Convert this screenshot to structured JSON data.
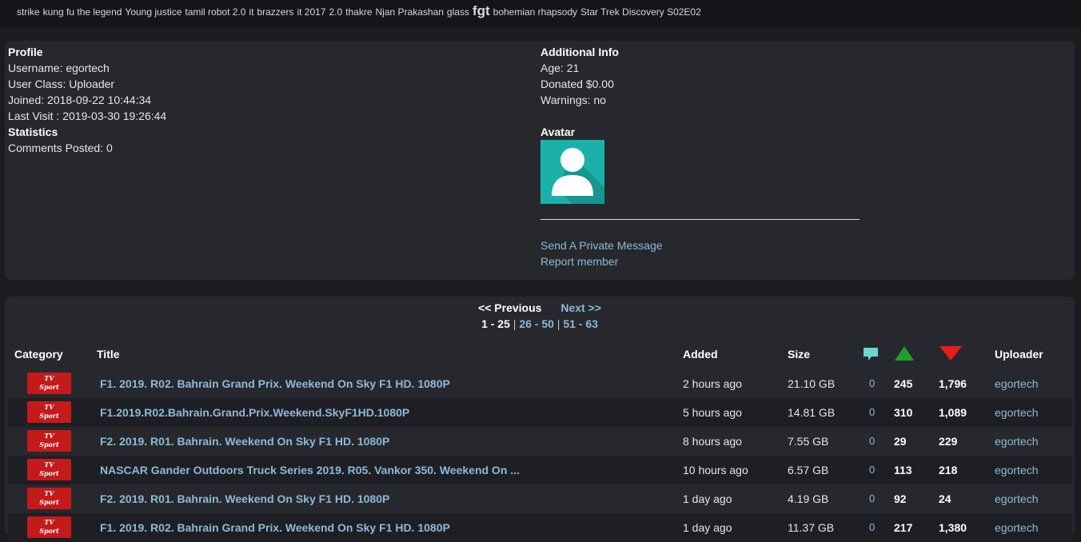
{
  "tag_cloud": [
    {
      "label": "strike",
      "big": false
    },
    {
      "label": "kung fu the legend",
      "big": false
    },
    {
      "label": "Young justice",
      "big": false
    },
    {
      "label": "tamil robot 2.0",
      "big": false
    },
    {
      "label": "it",
      "big": false
    },
    {
      "label": "brazzers",
      "big": false
    },
    {
      "label": "it 2017",
      "big": false
    },
    {
      "label": "2.0",
      "big": false
    },
    {
      "label": "thakre",
      "big": false
    },
    {
      "label": "Njan Prakashan",
      "big": false
    },
    {
      "label": "glass",
      "big": false
    },
    {
      "label": "fgt",
      "big": true
    },
    {
      "label": "bohemian rhapsody",
      "big": false
    },
    {
      "label": "Star Trek Discovery S02E02",
      "big": false
    }
  ],
  "profile": {
    "heading": "Profile",
    "username": "Username: egortech",
    "user_class": "User Class: Uploader",
    "joined": "Joined: 2018-09-22 10:44:34",
    "last_visit": "Last Visit : 2019-03-30 19:26:44",
    "stats_heading": "Statistics",
    "comments_posted": "Comments Posted: 0"
  },
  "additional": {
    "heading": "Additional Info",
    "age": "Age: 21",
    "donated": "Donated $0.00",
    "warnings": "Warnings: no",
    "avatar_heading": "Avatar",
    "send_pm": "Send A Private Message",
    "report": "Report member",
    "avatar_color": "#19b1a8"
  },
  "pager": {
    "prev": "<< Previous",
    "next": "Next >>",
    "current": "1 - 25",
    "sep": "|",
    "pages": [
      "26 - 50",
      "51 - 63"
    ]
  },
  "table": {
    "headers": {
      "category": "Category",
      "title": "Title",
      "added": "Added",
      "size": "Size",
      "uploader": "Uploader"
    },
    "category_badge": [
      "TV",
      "Sport"
    ],
    "rows": [
      {
        "title": "F1. 2019. R02. Bahrain Grand Prix. Weekend On Sky F1 HD. 1080P",
        "added": "2 hours ago",
        "size": "21.10 GB",
        "comments": "0",
        "seeders": "245",
        "leechers": "1,796",
        "uploader": "egortech"
      },
      {
        "title": "F1.2019.R02.Bahrain.Grand.Prix.Weekend.SkyF1HD.1080P",
        "added": "5 hours ago",
        "size": "14.81 GB",
        "comments": "0",
        "seeders": "310",
        "leechers": "1,089",
        "uploader": "egortech"
      },
      {
        "title": "F2. 2019. R01. Bahrain. Weekend On Sky F1 HD. 1080P",
        "added": "8 hours ago",
        "size": "7.55 GB",
        "comments": "0",
        "seeders": "29",
        "leechers": "229",
        "uploader": "egortech"
      },
      {
        "title": "NASCAR Gander Outdoors Truck Series 2019. R05. Vankor 350. Weekend On ...",
        "added": "10 hours ago",
        "size": "6.57 GB",
        "comments": "0",
        "seeders": "113",
        "leechers": "218",
        "uploader": "egortech"
      },
      {
        "title": "F2. 2019. R01. Bahrain. Weekend On Sky F1 HD. 1080P",
        "added": "1 day ago",
        "size": "4.19 GB",
        "comments": "0",
        "seeders": "92",
        "leechers": "24",
        "uploader": "egortech"
      },
      {
        "title": "F1. 2019. R02. Bahrain Grand Prix. Weekend On Sky F1 HD. 1080P",
        "added": "1 day ago",
        "size": "11.37 GB",
        "comments": "0",
        "seeders": "217",
        "leechers": "1,380",
        "uploader": "egortech"
      }
    ]
  },
  "colors": {
    "link": "#8fb8d8",
    "panel": "#26282e",
    "seed_icon": "#1e9e2a",
    "leech_icon": "#e81c1c",
    "comment_icon": "#6fd3cf"
  }
}
